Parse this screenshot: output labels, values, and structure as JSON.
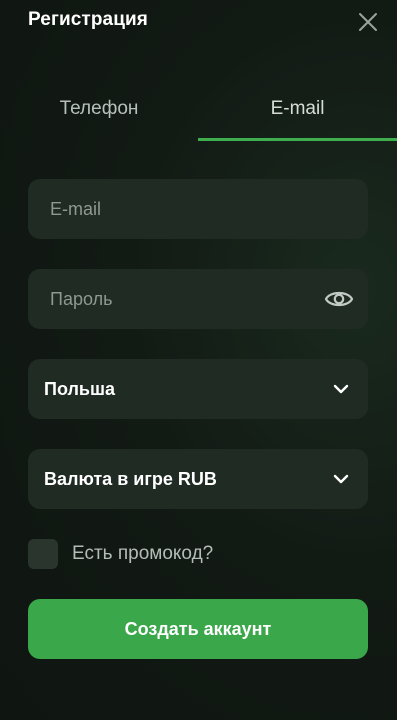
{
  "header": {
    "title": "Регистрация",
    "close_icon": "close-icon"
  },
  "tabs": [
    {
      "label": "Телефон",
      "active": false
    },
    {
      "label": "E-mail",
      "active": true
    }
  ],
  "form": {
    "email": {
      "placeholder": "E-mail",
      "value": ""
    },
    "password": {
      "placeholder": "Пароль",
      "value": "",
      "toggle_icon": "eye-icon"
    },
    "country": {
      "value": "Польша",
      "icon": "chevron-down-icon"
    },
    "currency": {
      "value": "Валюта в игре RUB",
      "icon": "chevron-down-icon"
    },
    "promo": {
      "label": "Есть промокод?",
      "checked": false
    },
    "submit_label": "Создать аккаунт"
  },
  "colors": {
    "background": "#121a14",
    "field": "#1f2b23",
    "accent": "#3aa74a",
    "tab_underline": "#3fae4f"
  }
}
